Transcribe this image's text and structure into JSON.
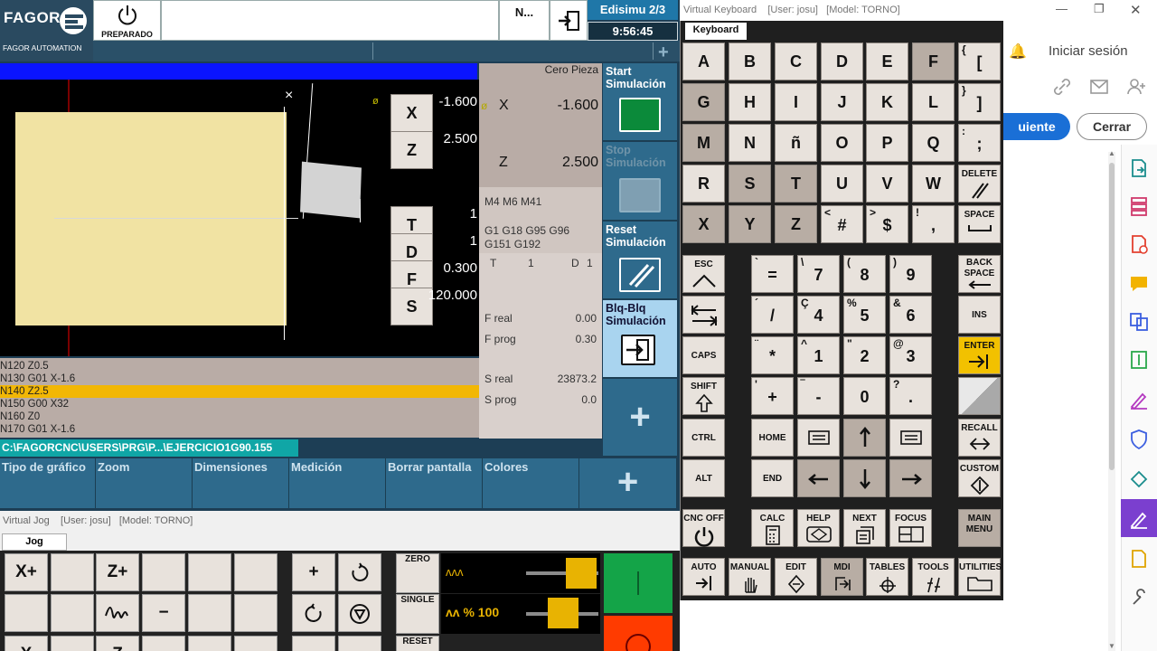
{
  "cnc": {
    "brand": "FAGOR",
    "brand_sub": "FAGOR AUTOMATION",
    "state_label": "PREPARADO",
    "n_label": "N...",
    "program_name": "Edisimu 2/3",
    "clock": "9:56:45",
    "graph": {
      "close_symbol": "×"
    },
    "coords": {
      "x_label": "X",
      "x_value": "-1.600",
      "z_label": "Z",
      "z_value": "2.500",
      "t_label": "T",
      "t_value": "1",
      "d_label": "D",
      "d_value": "1",
      "f_label": "F",
      "f_value": "0.300",
      "s_label": "S",
      "s_value": "120.000",
      "marker": "ø"
    },
    "info": {
      "title": "Cero Pieza",
      "x_label": "X",
      "x_value": "-1.600",
      "z_label": "Z",
      "z_value": "2.500",
      "mcodes": "M4 M6 M41",
      "gcodes_1": "G1 G18 G95 G96",
      "gcodes_2": "G151 G192",
      "t_label": "T",
      "t_value": "1",
      "d_label": "D",
      "d_value": "1",
      "freal_label": "F real",
      "freal_value": "0.00",
      "fprog_label": "F prog",
      "fprog_value": "0.30",
      "sreal_label": "S real",
      "sreal_value": "23873.2",
      "sprog_label": "S prog",
      "sprog_value": "0.0"
    },
    "side_softkeys": [
      {
        "label": "Start Simulación"
      },
      {
        "label": "Stop Simulación"
      },
      {
        "label": "Reset Simulación"
      },
      {
        "label": "Blq-Blq Simulación"
      },
      {
        "label": "+"
      }
    ],
    "program_lines": [
      "N120  Z0.5",
      "N130  G01 X-1.6",
      "N140  Z2.5",
      "N150  G00 X32",
      "N160  Z0",
      "N170  G01 X-1.6"
    ],
    "path": "C:\\FAGORCNC\\USERS\\PRG\\P...\\EJERCICIO1G90.155",
    "bottom_softkeys": [
      "Tipo de gráfico",
      "Zoom",
      "Dimensiones",
      "Medición",
      "Borrar pantalla",
      "Colores",
      "+"
    ]
  },
  "jog": {
    "title": "Virtual Jog",
    "user": "[User: josu]",
    "model": "[Model: TORNO]",
    "tab": "Jog",
    "keys_row1": [
      "X+",
      "",
      "Z+",
      "",
      "",
      ""
    ],
    "keys_row2": [
      "",
      "",
      "−",
      "",
      "",
      ""
    ],
    "keys_row3_visible": [
      "X",
      "",
      "Z"
    ],
    "zero_label": "ZERO",
    "single_label": "SINGLE",
    "reset_label": "RESET",
    "feed_override": "% 100"
  },
  "keyboard": {
    "title": "Virtual Keyboard",
    "user": "[User: josu]",
    "model": "[Model: TORNO]",
    "tab": "Keyboard",
    "alpha_rows": [
      [
        "A",
        "B",
        "C",
        "D",
        "E",
        "F"
      ],
      [
        "G",
        "H",
        "I",
        "J",
        "K",
        "L"
      ],
      [
        "M",
        "N",
        "ñ",
        "O",
        "P",
        "Q"
      ],
      [
        "R",
        "S",
        "T",
        "U",
        "V",
        "W"
      ],
      [
        "X",
        "Y",
        "Z",
        "#",
        "$",
        ","
      ]
    ],
    "symbol_col": [
      "[",
      "]",
      ";",
      "DELETE",
      "SPACE"
    ],
    "esc": "ESC",
    "caps": "CAPS",
    "shift": "SHIFT",
    "ctrl": "CTRL",
    "alt": "ALT",
    "home": "HOME",
    "end": "END",
    "backspace": "BACK SPACE",
    "ins": "INS",
    "enter": "ENTER",
    "recall": "RECALL",
    "custom": "CUSTOM",
    "num_rows": [
      [
        "=",
        "7",
        "8",
        "9"
      ],
      [
        "/",
        "4",
        "5",
        "6"
      ],
      [
        "*",
        "1",
        "2",
        "3"
      ],
      [
        "+",
        "-",
        "0",
        "."
      ]
    ],
    "fn_row": [
      "CNC OFF",
      "CALC",
      "HELP",
      "NEXT",
      "FOCUS",
      "MAIN MENU"
    ],
    "mode_row": [
      "AUTO",
      "MANUAL",
      "EDIT",
      "MDI",
      "TABLES",
      "TOOLS",
      "UTILITIES"
    ]
  },
  "browser": {
    "signin": "Iniciar sesión",
    "next_button": "uiente",
    "close_button": "Cerrar"
  }
}
